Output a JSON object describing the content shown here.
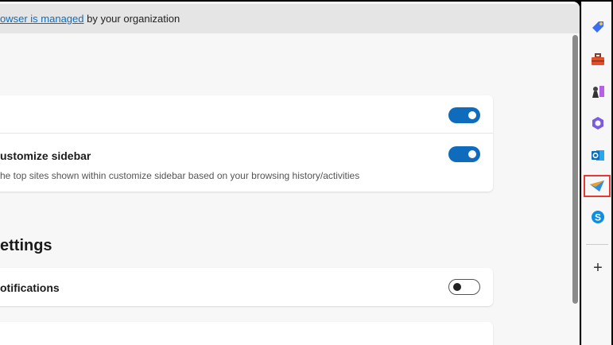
{
  "banner": {
    "link": "owser is managed",
    "text": " by your organization"
  },
  "card1": {
    "row2_title": "ustomize sidebar",
    "row2_desc": "he top sites shown within customize sidebar based on your browsing history/activities",
    "toggle1_on": true,
    "toggle2_on": true
  },
  "section": {
    "heading": "ettings"
  },
  "card2": {
    "title": "otifications",
    "toggle_on": false
  },
  "sidebar": {
    "icons": [
      "shopping-tag-icon",
      "tools-icon",
      "games-icon",
      "m365-icon",
      "outlook-icon",
      "telegram-icon",
      "skype-icon"
    ],
    "add": "+"
  },
  "colors": {
    "accent": "#0f6cbd"
  }
}
